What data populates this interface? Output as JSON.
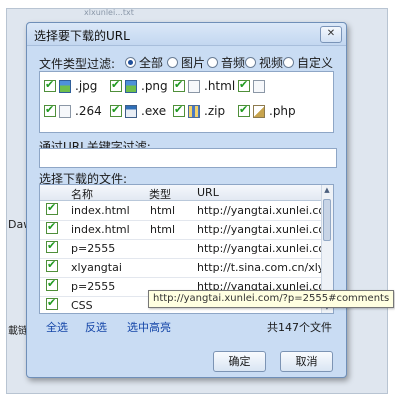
{
  "background": {
    "tab_label": "xlxunlei...txt",
    "side_text_1": "Daw",
    "side_text_2": "載链"
  },
  "dialog": {
    "title": "选择要下载的URL",
    "filter_type_label": "文件类型过滤:",
    "radios": [
      {
        "label": "全部",
        "checked": true
      },
      {
        "label": "图片",
        "checked": false
      },
      {
        "label": "音频",
        "checked": false
      },
      {
        "label": "视频",
        "checked": false
      },
      {
        "label": "自定义",
        "checked": false
      }
    ],
    "file_types": [
      {
        "label": ".jpg",
        "icon": "image-file-icon",
        "checked": true
      },
      {
        "label": ".png",
        "icon": "image-file-icon",
        "checked": true
      },
      {
        "label": ".html",
        "icon": "document-file-icon",
        "checked": true
      },
      {
        "label": "",
        "icon": "document-file-icon",
        "checked": true
      },
      {
        "label": ".264",
        "icon": "document-file-icon",
        "checked": true
      },
      {
        "label": ".exe",
        "icon": "executable-file-icon",
        "checked": true
      },
      {
        "label": ".zip",
        "icon": "zip-file-icon",
        "checked": true
      },
      {
        "label": ".php",
        "icon": "php-file-icon",
        "checked": true
      }
    ],
    "url_filter_label": "通过URL关键字过滤:",
    "url_filter_value": "",
    "files_label": "选择下载的文件:",
    "columns": {
      "name": "名称",
      "type": "类型",
      "url": "URL"
    },
    "rows": [
      {
        "name": "index.html",
        "type": "html",
        "url": "http://yangtai.xunlei.com/",
        "checked": true
      },
      {
        "name": "index.html",
        "type": "html",
        "url": "http://yangtai.xunlei.com/",
        "checked": true
      },
      {
        "name": "p=2555",
        "type": "",
        "url": "http://yangtai.xunlei.com/",
        "checked": true
      },
      {
        "name": "xlyangtai",
        "type": "",
        "url": "http://t.sina.com.cn/xlyang",
        "checked": true
      },
      {
        "name": "p=2555",
        "type": "",
        "url": "http://yangtai.xunlei.com/",
        "checked": true
      },
      {
        "name": "CSS",
        "type": "",
        "url": "",
        "checked": true
      }
    ],
    "tooltip": "http://yangtai.xunlei.com/?p=2555#comments",
    "select_all": "全选",
    "invert": "反选",
    "highlight": "选中高亮",
    "count": "共147个文件",
    "ok": "确定",
    "cancel": "取消",
    "close_symbol": "✕"
  },
  "colors": {
    "dialog_bg": "#c9dcf3",
    "check_green": "#1f9a1f",
    "link_blue": "#1546a8",
    "tooltip_bg": "#ffffe1"
  }
}
